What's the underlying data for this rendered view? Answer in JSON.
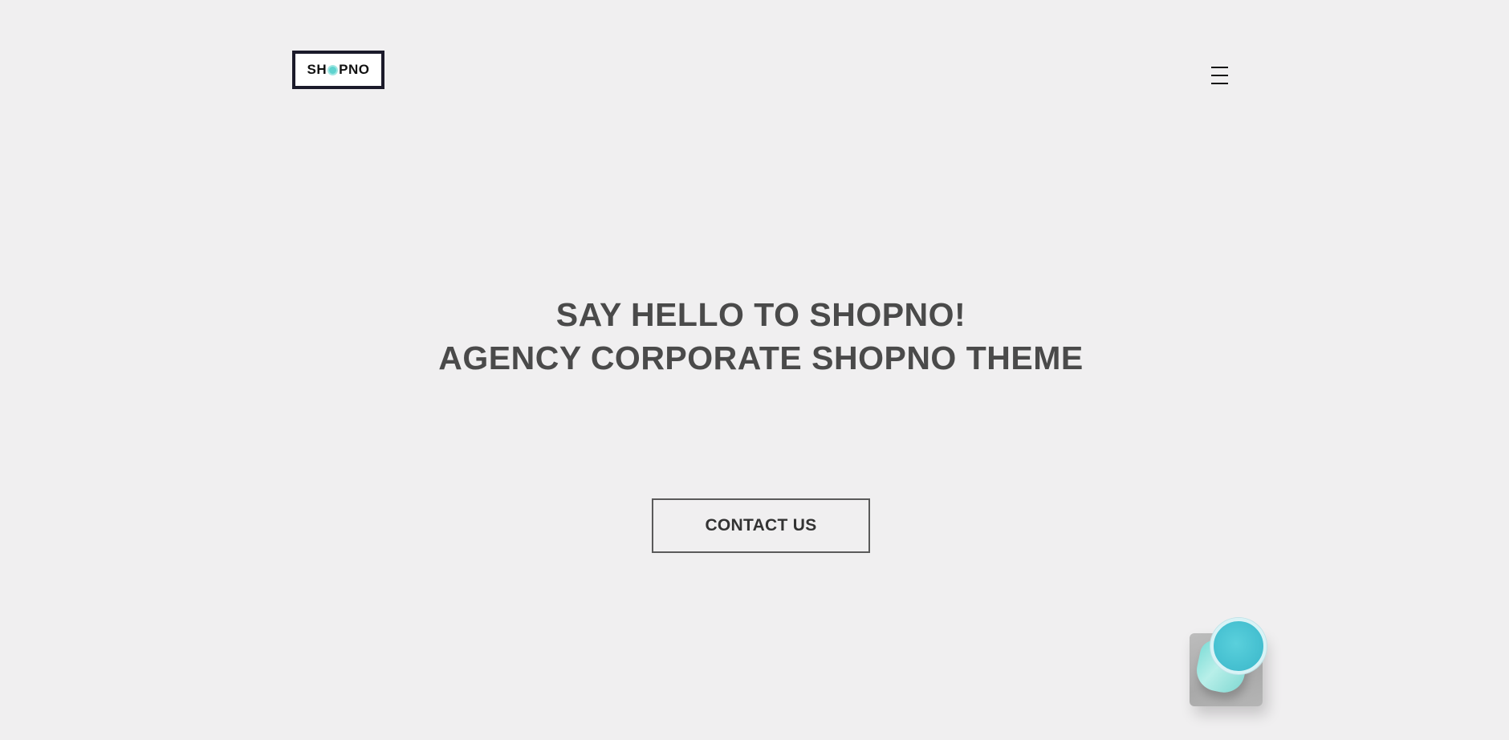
{
  "header": {
    "logo": {
      "text_before": "SH",
      "text_after": "PNO",
      "accent_color": "#5fd3cf",
      "icon": "logo-o-circle"
    },
    "menu_toggle": {
      "icon": "hamburger-menu-icon"
    }
  },
  "hero": {
    "title_line_1": "SAY HELLO TO SHOPNO!",
    "title_line_2": "AGENCY CORPORATE SHOPNO THEME",
    "cta_label": "CONTACT US"
  },
  "decoration": {
    "image": "blue-cup-on-coaster"
  },
  "colors": {
    "background": "#f0eff0",
    "text": "#4a4a4a",
    "logo_border": "#1b1a2a",
    "accent": "#5fd3cf"
  }
}
